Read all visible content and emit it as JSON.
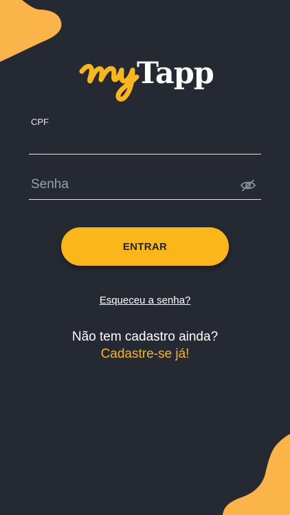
{
  "colors": {
    "background": "#252a32",
    "accent": "#fbb719",
    "text": "#ffffff",
    "placeholder": "#9aa0a8"
  },
  "logo": {
    "script_part": "my",
    "bold_part": "Tapp"
  },
  "form": {
    "cpf": {
      "label": "CPF",
      "value": ""
    },
    "senha": {
      "placeholder": "Senha",
      "value": "",
      "toggle_icon": "eye-off-icon"
    }
  },
  "actions": {
    "login_label": "ENTRAR",
    "forgot_password_label": "Esqueceu a senha?"
  },
  "signup": {
    "prompt": "Não tem cadastro ainda?",
    "link_label": "Cadastre-se já!"
  }
}
